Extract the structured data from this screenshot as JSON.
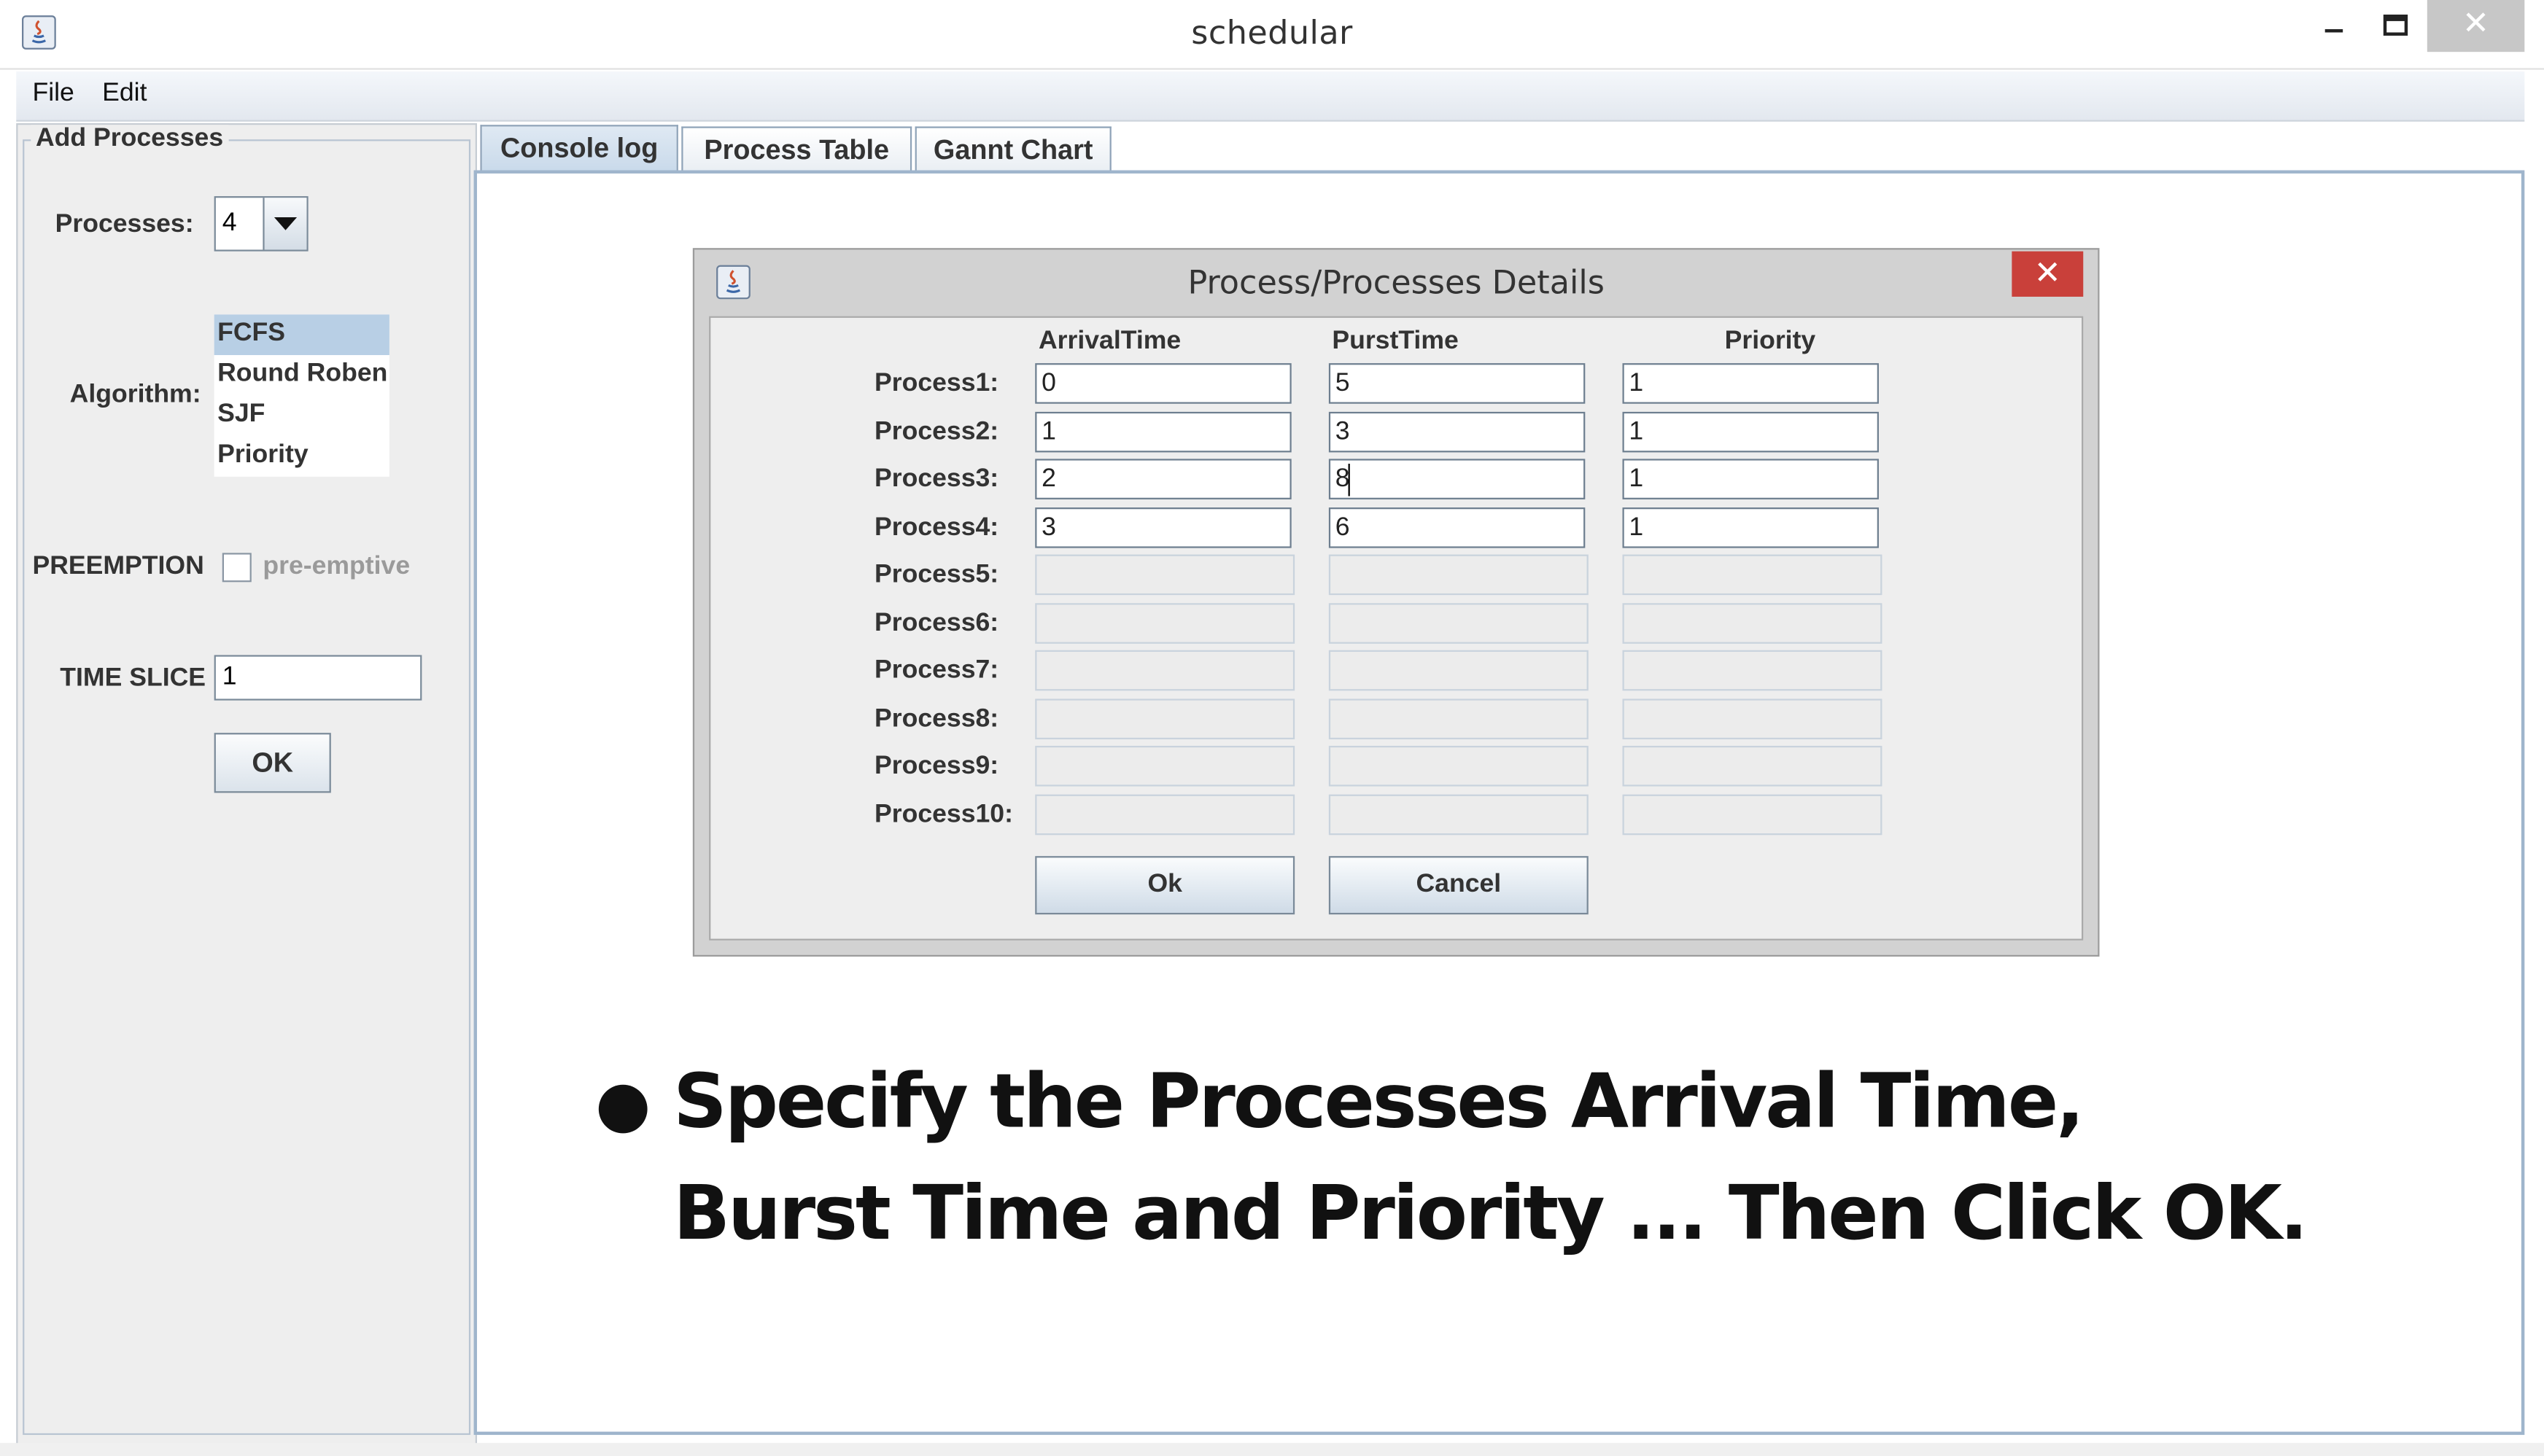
{
  "window": {
    "title": "schedular",
    "close_glyph": "✕"
  },
  "menu": {
    "file": "File",
    "edit": "Edit"
  },
  "left_panel": {
    "group_title": "Add Processes",
    "processes_label": "Processes:",
    "processes_value": "4",
    "algorithm_label": "Algorithm:",
    "algorithms": [
      "FCFS",
      "Round Roben",
      "SJF",
      "Priority"
    ],
    "selected_algorithm": "FCFS",
    "preemption_label": "PREEMPTION",
    "preemptive_text": "pre-emptive",
    "preemptive_checked": false,
    "time_slice_label": "TIME SLICE",
    "time_slice_value": "1",
    "ok_label": "OK"
  },
  "tabs": [
    "Console log",
    "Process Table",
    "Gannt Chart"
  ],
  "active_tab": "Console log",
  "dialog": {
    "title": "Process/Processes Details",
    "close_glyph": "✕",
    "columns": [
      "ArrivalTime",
      "PurstTime",
      "Priority"
    ],
    "rows": [
      {
        "label": "Process1:",
        "values": [
          "0",
          "5",
          "1"
        ]
      },
      {
        "label": "Process2:",
        "values": [
          "1",
          "3",
          "1"
        ]
      },
      {
        "label": "Process3:",
        "values": [
          "2",
          "8",
          "1"
        ]
      },
      {
        "label": "Process4:",
        "values": [
          "3",
          "6",
          "1"
        ]
      },
      {
        "label": "Process5:",
        "values": [
          "",
          "",
          ""
        ]
      },
      {
        "label": "Process6:",
        "values": [
          "",
          "",
          ""
        ]
      },
      {
        "label": "Process7:",
        "values": [
          "",
          "",
          ""
        ]
      },
      {
        "label": "Process8:",
        "values": [
          "",
          "",
          ""
        ]
      },
      {
        "label": "Process9:",
        "values": [
          "",
          "",
          ""
        ]
      },
      {
        "label": "Process10:",
        "values": [
          "",
          "",
          ""
        ]
      }
    ],
    "enabled_rows": 4,
    "ok_label": "Ok",
    "cancel_label": "Cancel"
  },
  "instruction": {
    "line1": "Specify the Processes Arrival Time,",
    "line2": "Burst Time and Priority ... Then Click OK."
  },
  "colors": {
    "selection": "#b8cfe5",
    "dialog_close": "#c9403a",
    "tab_active": "#c8d9ea",
    "border_blue": "#9fb5cc"
  }
}
